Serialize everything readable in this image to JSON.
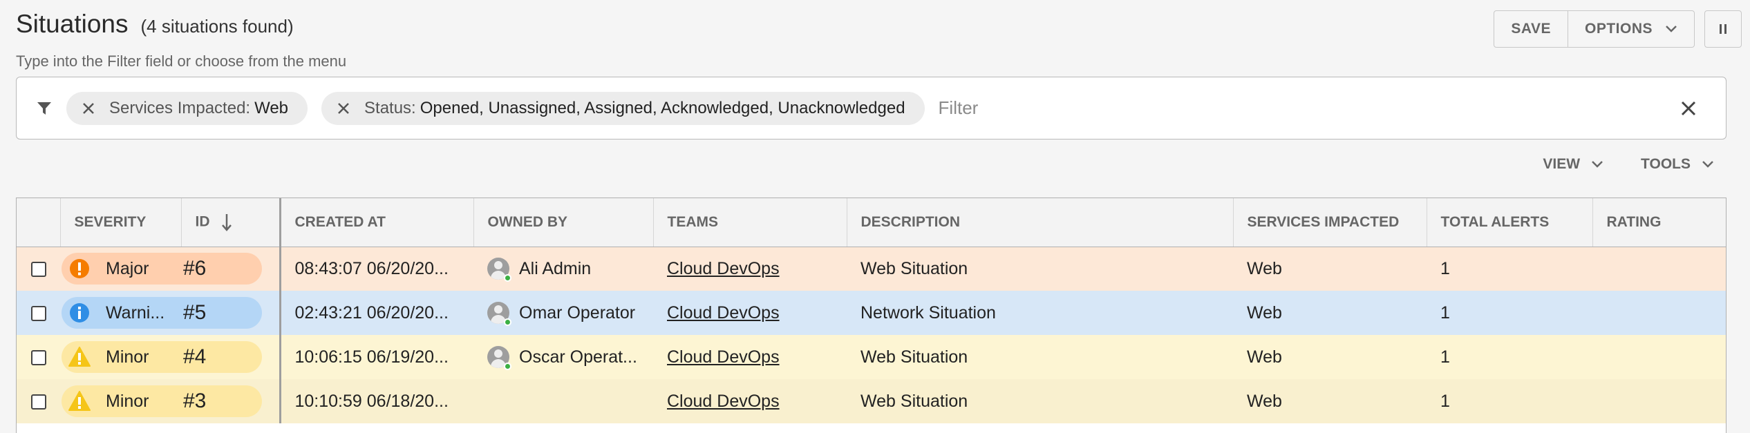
{
  "header": {
    "title": "Situations",
    "count": "(4 situations found)",
    "hint": "Type into the Filter field or choose from the menu"
  },
  "toolbar": {
    "save_label": "SAVE",
    "options_label": "OPTIONS"
  },
  "filters": {
    "chips": [
      {
        "key": "Services Impacted:",
        "value": "Web"
      },
      {
        "key": "Status:",
        "value": "Opened, Unassigned, Assigned, Acknowledged, Unacknowledged"
      }
    ],
    "placeholder": "Filter"
  },
  "view_tools": {
    "view_label": "VIEW",
    "tools_label": "TOOLS"
  },
  "grid": {
    "columns": [
      "SEVERITY",
      "ID",
      "CREATED AT",
      "OWNED BY",
      "TEAMS",
      "DESCRIPTION",
      "SERVICES IMPACTED",
      "TOTAL ALERTS",
      "RATING"
    ],
    "sort_column": "ID",
    "rows": [
      {
        "severity": "Major",
        "severity_icon": "error-icon",
        "id": "#6",
        "created_at": "08:43:07 06/20/20...",
        "owner": "Ali Admin",
        "owner_online": true,
        "team": "Cloud DevOps",
        "description": "Web Situation",
        "services": "Web",
        "total_alerts": "1",
        "rating": ""
      },
      {
        "severity": "Warni...",
        "severity_icon": "info-icon",
        "id": "#5",
        "created_at": "02:43:21 06/20/20...",
        "owner": "Omar Operator",
        "owner_online": true,
        "team": "Cloud DevOps",
        "description": "Network Situation",
        "services": "Web",
        "total_alerts": "1",
        "rating": ""
      },
      {
        "severity": "Minor",
        "severity_icon": "warning-icon",
        "id": "#4",
        "created_at": "10:06:15 06/19/20...",
        "owner": "Oscar Operat...",
        "owner_online": true,
        "team": "Cloud DevOps",
        "description": "Web Situation",
        "services": "Web",
        "total_alerts": "1",
        "rating": ""
      },
      {
        "severity": "Minor",
        "severity_icon": "warning-icon",
        "id": "#3",
        "created_at": "10:10:59 06/18/20...",
        "owner": "",
        "owner_online": false,
        "team": "Cloud DevOps",
        "description": "Web Situation",
        "services": "Web",
        "total_alerts": "1",
        "rating": ""
      }
    ]
  },
  "colors": {
    "major": "#f57c00",
    "warning": "#2f8ee5",
    "minor": "#f5c518",
    "row_major": "#fde8d7",
    "row_warning": "#d7e7f7",
    "row_minor": "#fdf5d3"
  }
}
